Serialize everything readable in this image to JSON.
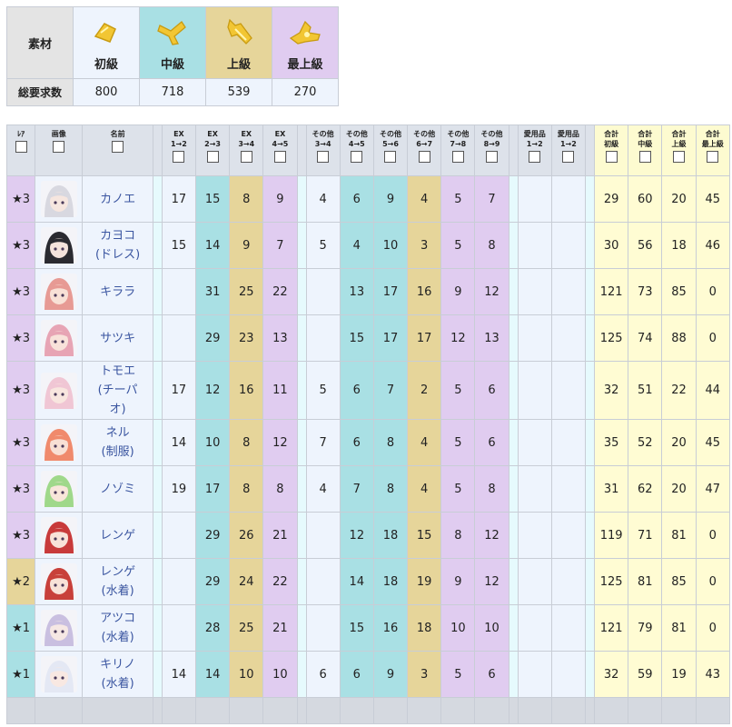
{
  "summary": {
    "material_label": "素材",
    "total_label": "総要求数",
    "tiers": [
      {
        "name": "初級",
        "count": "800",
        "icon": "gold-pill-small-icon"
      },
      {
        "name": "中級",
        "count": "718",
        "icon": "gold-pill-medium-icon"
      },
      {
        "name": "上級",
        "count": "539",
        "icon": "gold-pill-large-icon"
      },
      {
        "name": "最上級",
        "count": "270",
        "icon": "gold-pill-superior-icon"
      }
    ]
  },
  "columns": {
    "rarity": "ﾚｱ",
    "image": "画像",
    "name": "名前",
    "ex": [
      [
        "EX",
        "1→2"
      ],
      [
        "EX",
        "2→3"
      ],
      [
        "EX",
        "3→4"
      ],
      [
        "EX",
        "4→5"
      ]
    ],
    "other": [
      [
        "その他",
        "3→4"
      ],
      [
        "その他",
        "4→5"
      ],
      [
        "その他",
        "5→6"
      ],
      [
        "その他",
        "6→7"
      ],
      [
        "その他",
        "7→8"
      ],
      [
        "その他",
        "8→9"
      ]
    ],
    "gift": [
      [
        "愛用品",
        "1→2"
      ],
      [
        "愛用品",
        "1→2"
      ]
    ],
    "total": [
      [
        "合計",
        "初級"
      ],
      [
        "合計",
        "中級"
      ],
      [
        "合計",
        "上級"
      ],
      [
        "合計",
        "最上級"
      ]
    ]
  },
  "rows": [
    {
      "rarity": "★3",
      "rar": 3,
      "name": [
        "カノエ"
      ],
      "ex": [
        "17",
        "15",
        "8",
        "9"
      ],
      "other": [
        "4",
        "6",
        "9",
        "4",
        "5",
        "7"
      ],
      "total": [
        "29",
        "60",
        "20",
        "45"
      ],
      "hair": "#d8d8e0",
      "skin": "#f6e6df"
    },
    {
      "rarity": "★3",
      "rar": 3,
      "name": [
        "カヨコ",
        "(ドレス)"
      ],
      "ex": [
        "15",
        "14",
        "9",
        "7"
      ],
      "other": [
        "5",
        "4",
        "10",
        "3",
        "5",
        "8"
      ],
      "total": [
        "30",
        "56",
        "18",
        "46"
      ],
      "hair": "#2a2a30",
      "skin": "#f4e3dc"
    },
    {
      "rarity": "★3",
      "rar": 3,
      "name": [
        "キララ"
      ],
      "ex": [
        "",
        "31",
        "25",
        "22"
      ],
      "other": [
        "",
        "13",
        "17",
        "16",
        "9",
        "12"
      ],
      "total": [
        "121",
        "73",
        "85",
        "0"
      ],
      "hair": "#e79a94",
      "skin": "#f8e1d6"
    },
    {
      "rarity": "★3",
      "rar": 3,
      "name": [
        "サツキ"
      ],
      "ex": [
        "",
        "29",
        "23",
        "13"
      ],
      "other": [
        "",
        "15",
        "17",
        "17",
        "12",
        "13"
      ],
      "total": [
        "125",
        "74",
        "88",
        "0"
      ],
      "hair": "#e7a4b4",
      "skin": "#f8e2da"
    },
    {
      "rarity": "★3",
      "rar": 3,
      "name": [
        "トモエ",
        "(チーパ",
        "オ)"
      ],
      "ex": [
        "17",
        "12",
        "16",
        "11"
      ],
      "other": [
        "5",
        "6",
        "7",
        "2",
        "5",
        "6"
      ],
      "total": [
        "32",
        "51",
        "22",
        "44"
      ],
      "hair": "#f0c6d4",
      "skin": "#f8e6df"
    },
    {
      "rarity": "★3",
      "rar": 3,
      "name": [
        "ネル",
        "(制服)"
      ],
      "ex": [
        "14",
        "10",
        "8",
        "12"
      ],
      "other": [
        "7",
        "6",
        "8",
        "4",
        "5",
        "6"
      ],
      "total": [
        "35",
        "52",
        "20",
        "45"
      ],
      "hair": "#f08a6c",
      "skin": "#f8e0d4"
    },
    {
      "rarity": "★3",
      "rar": 3,
      "name": [
        "ノゾミ"
      ],
      "ex": [
        "19",
        "17",
        "8",
        "8"
      ],
      "other": [
        "4",
        "7",
        "8",
        "4",
        "5",
        "8"
      ],
      "total": [
        "31",
        "62",
        "20",
        "47"
      ],
      "hair": "#9fd88a",
      "skin": "#f8e6da"
    },
    {
      "rarity": "★3",
      "rar": 3,
      "name": [
        "レンゲ"
      ],
      "ex": [
        "",
        "29",
        "26",
        "21"
      ],
      "other": [
        "",
        "12",
        "18",
        "15",
        "8",
        "12"
      ],
      "total": [
        "119",
        "71",
        "81",
        "0"
      ],
      "hair": "#c83a3a",
      "skin": "#f8e2d8"
    },
    {
      "rarity": "★2",
      "rar": 2,
      "name": [
        "レンゲ",
        "(水着)"
      ],
      "ex": [
        "",
        "29",
        "24",
        "22"
      ],
      "other": [
        "",
        "14",
        "18",
        "19",
        "9",
        "12"
      ],
      "total": [
        "125",
        "81",
        "85",
        "0"
      ],
      "hair": "#c8403a",
      "skin": "#f8e2d8"
    },
    {
      "rarity": "★1",
      "rar": 1,
      "name": [
        "アツコ",
        "(水着)"
      ],
      "ex": [
        "",
        "28",
        "25",
        "21"
      ],
      "other": [
        "",
        "15",
        "16",
        "18",
        "10",
        "10"
      ],
      "total": [
        "121",
        "79",
        "81",
        "0"
      ],
      "hair": "#c9bfe0",
      "skin": "#f6e8e4"
    },
    {
      "rarity": "★1",
      "rar": 1,
      "name": [
        "キリノ",
        "(水着)"
      ],
      "ex": [
        "14",
        "14",
        "10",
        "10"
      ],
      "other": [
        "6",
        "6",
        "9",
        "3",
        "5",
        "6"
      ],
      "total": [
        "32",
        "59",
        "19",
        "43"
      ],
      "hair": "#e4e8f4",
      "skin": "#f8e8e2"
    }
  ]
}
